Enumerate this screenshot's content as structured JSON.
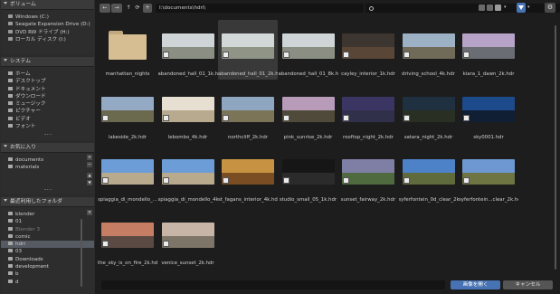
{
  "sidebar": {
    "volumes": {
      "title": "ボリューム",
      "items": [
        "Windows (C:)",
        "Seagate Expansion Drive (D:)",
        "DVD RW ドライブ (H:)",
        "ローカル ディスク (I:)"
      ]
    },
    "system": {
      "title": "システム",
      "items": [
        "ホーム",
        "デスクトップ",
        "ドキュメント",
        "ダウンロード",
        "ミュージック",
        "ピクチャー",
        "ビデオ",
        "フォント"
      ]
    },
    "favorites": {
      "title": "お気に入り",
      "items": [
        "documents",
        "materials"
      ]
    },
    "recent": {
      "title": "最近利用したフォルダ",
      "items": [
        "blender",
        "01",
        "Blender 3",
        "comic",
        "hdri",
        "03",
        "Downloads",
        "development",
        "b",
        "d"
      ],
      "selected": "hdri",
      "dimmed": "Blender 3"
    }
  },
  "toolbar": {
    "back_icon": "←",
    "forward_icon": "→",
    "parent_icon": "↑",
    "refresh_icon": "⟳",
    "new_folder_icon": "+",
    "path": "I:\\documents\\hdri\\",
    "search_placeholder": "",
    "view_icon": "grid-view",
    "filter_icon": "funnel",
    "settings_icon": "gear"
  },
  "files": [
    {
      "name": "manhattan_nights",
      "kind": "folder"
    },
    {
      "name": "abandoned_hall_01_1k.h...",
      "kind": "hdr",
      "sky": "#cfd5d6",
      "ground": "#8b8f83"
    },
    {
      "name": "abandoned_hall_01_2k.h...",
      "kind": "hdr",
      "sky": "#d2d8d8",
      "ground": "#8f9486",
      "selected": true
    },
    {
      "name": "abandoned_hall_01_8k.h...",
      "kind": "hdr",
      "sky": "#cfd5d6",
      "ground": "#8b8f83"
    },
    {
      "name": "cayley_interior_1k.hdr",
      "kind": "hdr",
      "sky": "#3c3530",
      "ground": "#5a4636"
    },
    {
      "name": "driving_school_4k.hdr",
      "kind": "hdr",
      "sky": "#9db1c4",
      "ground": "#6f6b58"
    },
    {
      "name": "kiara_1_dawn_2k.hdr",
      "kind": "hdr",
      "sky": "#b7a3c8",
      "ground": "#6a6d73"
    },
    {
      "name": "lakeside_2k.hdr",
      "kind": "hdr",
      "sky": "#94a9c4",
      "ground": "#6c6a4e"
    },
    {
      "name": "lebombo_4k.hdr",
      "kind": "hdr",
      "sky": "#e6dfd2",
      "ground": "#b8aa8e"
    },
    {
      "name": "northcliff_2k.hdr",
      "kind": "hdr",
      "sky": "#8fa6c0",
      "ground": "#7c7456"
    },
    {
      "name": "pink_sunrise_2k.hdr",
      "kind": "hdr",
      "sky": "#b89ab9",
      "ground": "#4f4a3a"
    },
    {
      "name": "rooftop_night_2k.hdr",
      "kind": "hdr",
      "sky": "#3b3563",
      "ground": "#31304a"
    },
    {
      "name": "satara_night_2k.hdr",
      "kind": "hdr",
      "sky": "#1f3040",
      "ground": "#2a2f24"
    },
    {
      "name": "sky0001.hdr",
      "kind": "hdr",
      "sky": "#1d4a8a",
      "ground": "#101f33"
    },
    {
      "name": "spiaggia_di_mondello_...",
      "kind": "hdr",
      "sky": "#6d9dd6",
      "ground": "#b8aa8d"
    },
    {
      "name": "spiaggia_di_mondello_4k...",
      "kind": "hdr",
      "sky": "#6d9dd6",
      "ground": "#b8aa8d"
    },
    {
      "name": "st_fagans_interior_4k.hdr",
      "kind": "hdr",
      "sky": "#c79342",
      "ground": "#7a4d22"
    },
    {
      "name": "studio_small_05_1k.hdr",
      "kind": "hdr",
      "sky": "#161616",
      "ground": "#2b2b2b"
    },
    {
      "name": "sunset_fairway_2k.hdr",
      "kind": "hdr",
      "sky": "#7f7ea5",
      "ground": "#4f6a3e"
    },
    {
      "name": "syferfontein_0d_clear_2k...",
      "kind": "hdr",
      "sky": "#4d82c9",
      "ground": "#5f6b3c"
    },
    {
      "name": "syferfontein...clear_2k.hdr",
      "kind": "hdr",
      "sky": "#6d98d2",
      "ground": "#6f7443"
    },
    {
      "name": "the_sky_is_on_fire_2k.hdr",
      "kind": "hdr",
      "sky": "#c57e64",
      "ground": "#5a4a43"
    },
    {
      "name": "venice_sunset_2k.hdr",
      "kind": "hdr",
      "sky": "#c7b6a7",
      "ground": "#7c7568"
    }
  ],
  "footer": {
    "open_label": "画像を開く",
    "cancel_label": "キャンセル"
  }
}
